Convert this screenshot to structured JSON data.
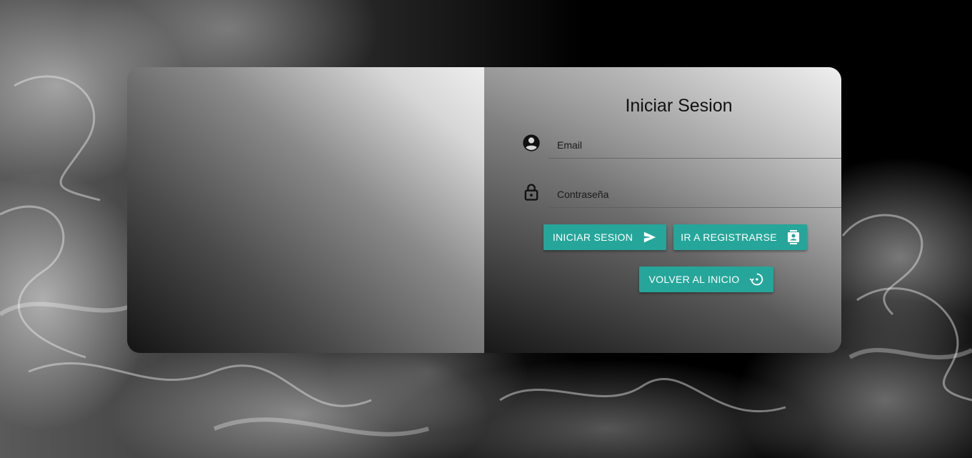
{
  "login": {
    "title": "Iniciar Sesion",
    "email": {
      "placeholder": "Email",
      "value": "",
      "icon": "account-circle-icon"
    },
    "password": {
      "placeholder": "Contraseña",
      "value": "",
      "icon": "lock-open-icon"
    },
    "buttons": {
      "login": {
        "label": "INICIAR SESION",
        "icon": "send-icon"
      },
      "register": {
        "label": "IR A REGISTRARSE",
        "icon": "contact-card-icon"
      },
      "home": {
        "label": "VOLVER AL INICIO",
        "icon": "history-icon"
      }
    }
  },
  "colors": {
    "accent": "#26a69a",
    "background": "#000000",
    "text": "#111111"
  }
}
